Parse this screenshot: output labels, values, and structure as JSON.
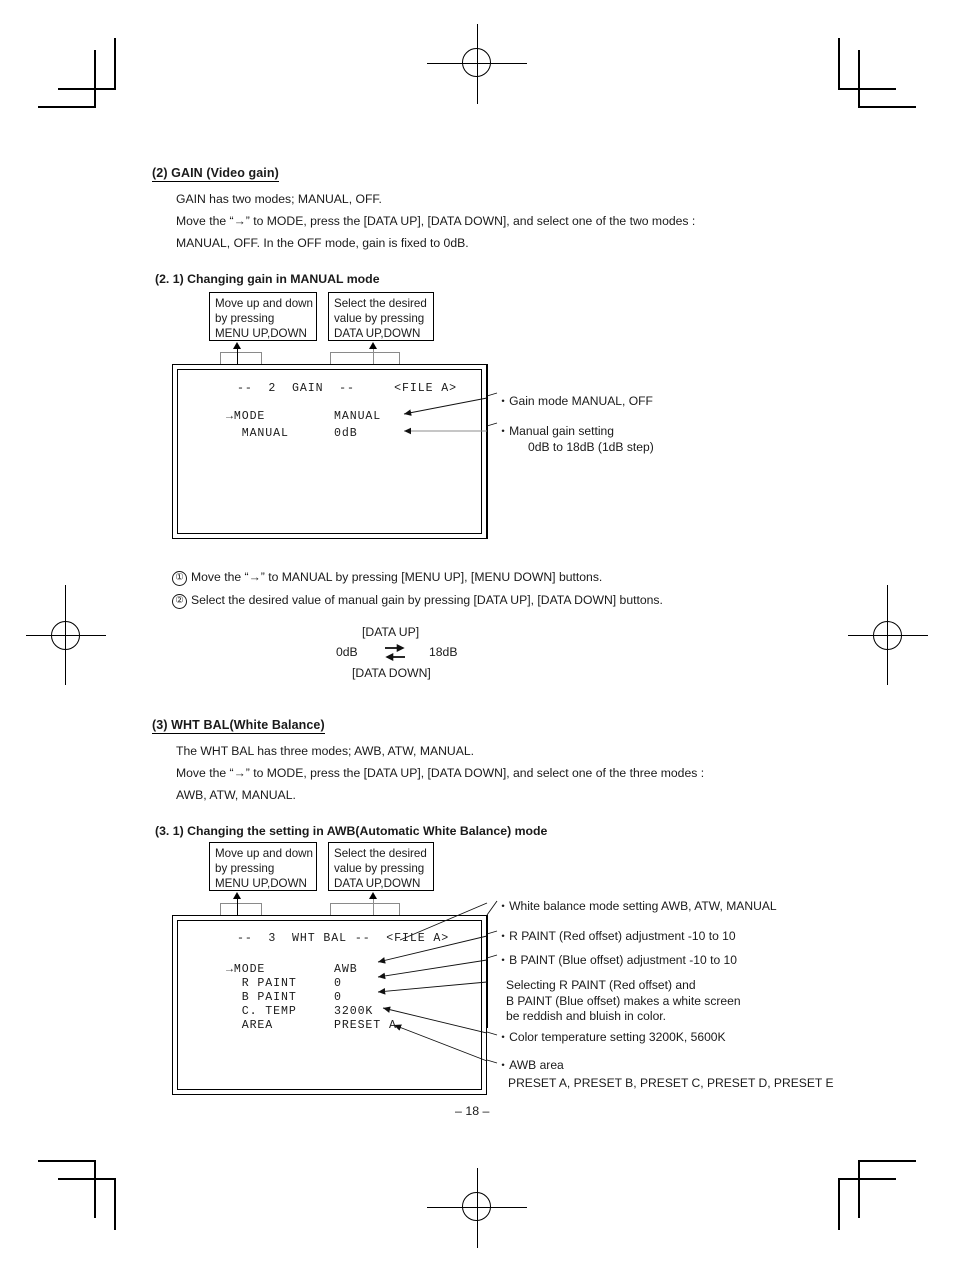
{
  "page": {
    "number_label": "– 18 –"
  },
  "section_gain": {
    "heading": "(2)  GAIN (Video gain)",
    "lines": [
      "GAIN has two modes; MANUAL, OFF.",
      "Move the “→” to MODE, press the [DATA UP], [DATA DOWN], and select one of the two modes :",
      "MANUAL, OFF.  In the OFF mode, gain is fixed to 0dB."
    ],
    "subheading": "(2. 1)  Changing gain in MANUAL mode",
    "callout_left": [
      "Move up and down",
      "by pressing",
      "MENU UP,DOWN"
    ],
    "callout_right": [
      "Select the desired",
      "value by pressing",
      "DATA UP,DOWN"
    ],
    "osd": {
      "title": "--  2  GAIN  --     <FILE A>",
      "rows": [
        {
          "label": "→MODE",
          "value": "MANUAL"
        },
        {
          "label": "  MANUAL",
          "value": "0dB"
        }
      ]
    },
    "annotations": [
      {
        "bullet": "・",
        "text": "Gain mode    MANUAL, OFF",
        "sub": ""
      },
      {
        "bullet": "・",
        "text": "Manual gain setting",
        "sub": "0dB to 18dB (1dB step)"
      }
    ],
    "steps": [
      {
        "marker": "①",
        "text": "Move the “→” to MANUAL by pressing [MENU UP], [MENU DOWN] buttons."
      },
      {
        "marker": "②",
        "text": "Select the desired value of manual gain by pressing [DATA UP], [DATA DOWN] buttons."
      }
    ],
    "range_diagram": {
      "top_label": "[DATA UP]",
      "left_label": "0dB",
      "right_label": "18dB",
      "bottom_label": "[DATA DOWN]"
    }
  },
  "section_whtbal": {
    "heading": "(3)  WHT BAL(White Balance)",
    "lines": [
      "The WHT BAL has three modes; AWB, ATW, MANUAL.",
      "Move the “→” to MODE, press the [DATA UP], [DATA DOWN], and select one of the three modes :",
      "AWB, ATW, MANUAL."
    ],
    "subheading": "(3. 1)  Changing the setting in AWB(Automatic White Balance) mode",
    "callout_left": [
      "Move up and down",
      "by pressing",
      "MENU UP,DOWN"
    ],
    "callout_right": [
      "Select the desired",
      "value by pressing",
      "DATA UP,DOWN"
    ],
    "osd": {
      "title": "--  3  WHT BAL --  <FILE A>",
      "rows": [
        {
          "label": "→MODE",
          "value": "AWB"
        },
        {
          "label": "  R PAINT",
          "value": "0"
        },
        {
          "label": "  B PAINT",
          "value": "0"
        },
        {
          "label": "  C. TEMP",
          "value": "3200K"
        },
        {
          "label": "  AREA",
          "value": "PRESET A"
        }
      ]
    },
    "annotations": [
      {
        "bullet": "・",
        "text": "White balance mode setting    AWB, ATW, MANUAL"
      },
      {
        "bullet": "・",
        "text": "R PAINT (Red offset) adjustment    -10 to 10"
      },
      {
        "bullet": "・",
        "text": "B PAINT (Blue offset) adjustment    -10 to 10"
      },
      {
        "bullet": "・",
        "text": "Color temperature setting    3200K, 5600K"
      },
      {
        "bullet": "・",
        "text": "AWB area"
      }
    ],
    "note_block": [
      "Selecting R PAINT (Red offset) and",
      "B PAINT (Blue offset) makes a white screen",
      "be reddish and bluish in color."
    ],
    "awb_area_values": "PRESET A, PRESET B, PRESET C, PRESET D, PRESET E"
  }
}
